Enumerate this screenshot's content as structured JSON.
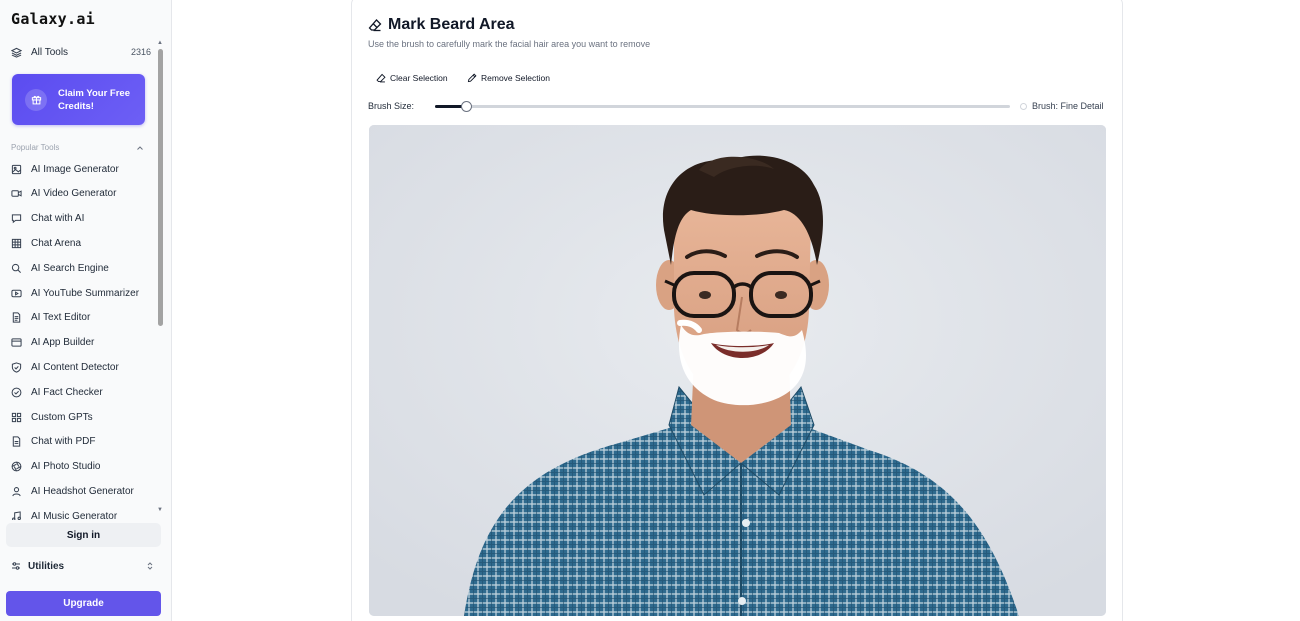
{
  "app": {
    "logo": "Galaxy.ai"
  },
  "sidebar": {
    "all_tools": {
      "label": "All Tools",
      "count": "2316",
      "icon": "layers-icon"
    },
    "promo": {
      "label": "Claim Your Free Credits!",
      "icon": "gift-icon"
    },
    "popular_label": "Popular Tools",
    "items": [
      {
        "label": "AI Image Generator",
        "icon": "image-icon"
      },
      {
        "label": "AI Video Generator",
        "icon": "video-icon"
      },
      {
        "label": "Chat with AI",
        "icon": "chat-icon"
      },
      {
        "label": "Chat Arena",
        "icon": "grid-icon"
      },
      {
        "label": "AI Search Engine",
        "icon": "search-icon"
      },
      {
        "label": "AI YouTube Summarizer",
        "icon": "youtube-icon"
      },
      {
        "label": "AI Text Editor",
        "icon": "document-icon"
      },
      {
        "label": "AI App Builder",
        "icon": "app-window-icon"
      },
      {
        "label": "AI Content Detector",
        "icon": "shield-icon"
      },
      {
        "label": "AI Fact Checker",
        "icon": "check-circle-icon"
      },
      {
        "label": "Custom GPTs",
        "icon": "apps-icon"
      },
      {
        "label": "Chat with PDF",
        "icon": "pdf-icon"
      },
      {
        "label": "AI Photo Studio",
        "icon": "aperture-icon"
      },
      {
        "label": "AI Headshot Generator",
        "icon": "user-icon"
      },
      {
        "label": "AI Music Generator",
        "icon": "music-icon"
      }
    ],
    "sign_in": "Sign in",
    "utilities": "Utilities",
    "upgrade": "Upgrade"
  },
  "main": {
    "title": "Mark Beard Area",
    "title_icon": "eraser-icon",
    "subtitle": "Use the brush to carefully mark the facial hair area you want to remove",
    "clear_selection": "Clear Selection",
    "remove_selection": "Remove Selection",
    "brush_size_label": "Brush Size:",
    "brush_size_value": 0.05,
    "brush_mode": "Brush: Fine Detail"
  },
  "colors": {
    "accent": "#6355ea",
    "promo": "#5b4cf0",
    "canvas_bg": "#dde1e7",
    "shirt": "#2e6a8e"
  }
}
